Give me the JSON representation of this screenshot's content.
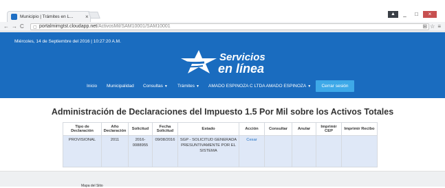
{
  "browser": {
    "tab_title": "Municipio | Trámites en L...",
    "tab_close": "×",
    "url_host": "portalmimgtst.cloudapp.net",
    "url_path": "/ActivosMil/SAM10001/SAM10001",
    "back_icon": "←",
    "forward_icon": "→",
    "reload_icon": "C",
    "user_icon": "▲",
    "minimize": "_",
    "maximize": "□",
    "close": "×",
    "translate_icon": "⊞",
    "star_icon": "☆",
    "menu_icon": "≡"
  },
  "header": {
    "datetime": "Miércoles, 14 de Septiembre del 2016 | 10:27:20 A.M.",
    "logo_line1": "Servicios",
    "logo_line2": "en línea",
    "nav": {
      "inicio": "Inicio",
      "municipalidad": "Municipalidad",
      "consultas": "Consultas",
      "tramites": "Trámites",
      "user": "AMADO ESPINOZA C LTDA AMADO ESPINOZA",
      "caret": "▼"
    },
    "logout": "Cerrar sesión",
    "colors": {
      "header_bg": "#1a6cbf",
      "logout_bg": "#3ea9e8"
    }
  },
  "main": {
    "title": "Administración de Declaraciones del Impuesto 1.5 Por Mil sobre los Activos Totales",
    "table": {
      "headers": [
        "Tipo de Declaración",
        "Año Declaración",
        "Solicitud",
        "Fecha Solicitud",
        "Estado",
        "Acción",
        "Consultar",
        "Anular",
        "Imprimir CEP",
        "Imprimir Recibo"
      ],
      "rows": [
        {
          "tipo": "PROVISIONAL",
          "anio": "2011",
          "solicitud": "2016-0088955",
          "fecha": "09/08/2016",
          "estado": "SGP - SOLICITUD GENERADA PRESUNTIVAMENTE POR EL SISTEMA",
          "accion": "Cesar",
          "consultar": "",
          "anular": "",
          "imprimir_cep": "",
          "imprimir_recibo": ""
        }
      ]
    }
  },
  "footer": {
    "text": "Mapa del Sitio"
  }
}
